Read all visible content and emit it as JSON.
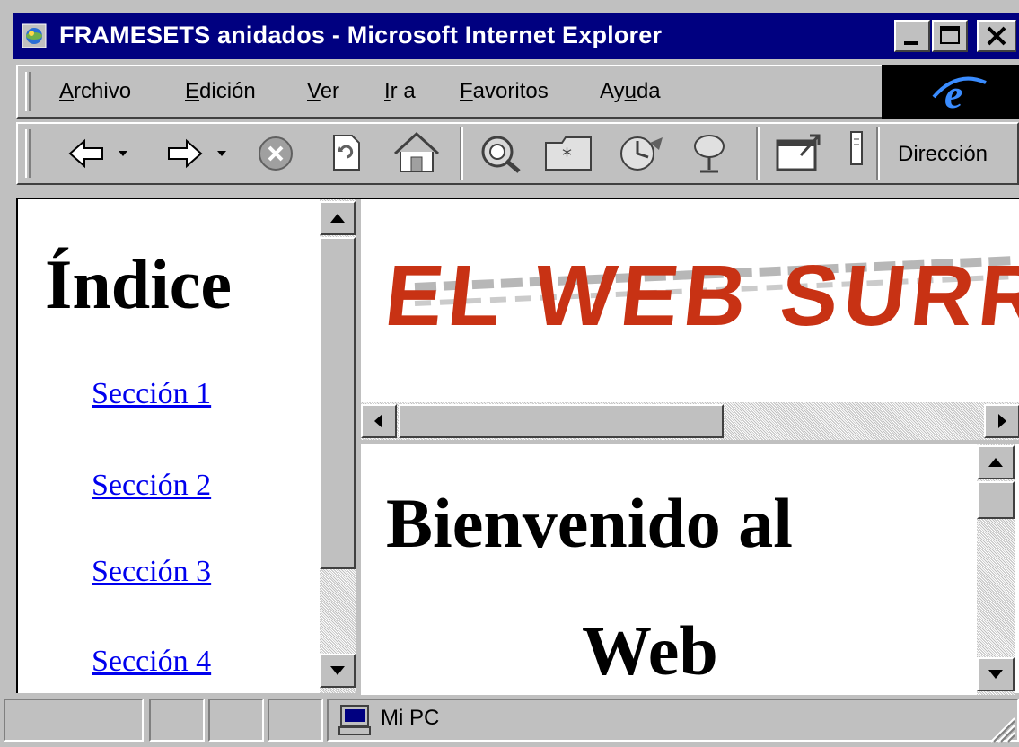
{
  "window": {
    "title": "FRAMESETS anidados - Microsoft Internet Explorer"
  },
  "menu": {
    "items": [
      {
        "pre": "",
        "u": "A",
        "post": "rchivo"
      },
      {
        "pre": "",
        "u": "E",
        "post": "dición"
      },
      {
        "pre": "",
        "u": "V",
        "post": "er"
      },
      {
        "pre": "",
        "u": "I",
        "post": "r a"
      },
      {
        "pre": "",
        "u": "F",
        "post": "avoritos"
      },
      {
        "pre": "Ay",
        "u": "u",
        "post": "da"
      }
    ]
  },
  "toolbar": {
    "buttons": [
      "back-icon",
      "forward-icon",
      "stop-icon",
      "refresh-icon",
      "home-icon",
      "search-icon",
      "favorites-icon",
      "history-icon",
      "channels-icon",
      "fullscreen-icon",
      "mail-icon"
    ],
    "address_label": "Dirección"
  },
  "index_frame": {
    "heading": "Índice",
    "links": [
      "Sección 1",
      "Sección 2",
      "Sección 3",
      "Sección 4"
    ]
  },
  "banner_frame": {
    "banner_text": "EL WEB SURR",
    "banner_color": "#c83214"
  },
  "main_frame": {
    "heading_line1": "Bienvenido al",
    "heading_line2": "Web"
  },
  "statusbar": {
    "zone": "Mi PC"
  }
}
